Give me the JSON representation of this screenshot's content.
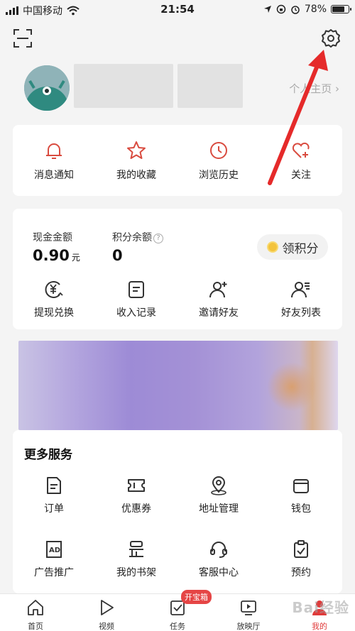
{
  "status_bar": {
    "carrier": "中国移动",
    "time": "21:54",
    "battery": "78%"
  },
  "profile": {
    "link_label": "个人主页 ›"
  },
  "quick_actions": [
    {
      "label": "消息通知",
      "icon": "bell-icon"
    },
    {
      "label": "我的收藏",
      "icon": "star-icon"
    },
    {
      "label": "浏览历史",
      "icon": "clock-icon"
    },
    {
      "label": "关注",
      "icon": "heart-plus-icon"
    }
  ],
  "wallet": {
    "cash_label": "现金金额",
    "cash_value": "0.90",
    "cash_unit": "元",
    "points_label": "积分余额",
    "points_value": "0",
    "claim_label": "领积分",
    "actions": [
      {
        "label": "提现兑换",
        "icon": "yuan-exchange-icon"
      },
      {
        "label": "收入记录",
        "icon": "record-icon"
      },
      {
        "label": "邀请好友",
        "icon": "add-friend-icon"
      },
      {
        "label": "好友列表",
        "icon": "friend-list-icon"
      }
    ]
  },
  "more_services": {
    "title": "更多服务",
    "items": [
      {
        "label": "订单",
        "icon": "order-icon"
      },
      {
        "label": "优惠券",
        "icon": "coupon-icon"
      },
      {
        "label": "地址管理",
        "icon": "location-icon"
      },
      {
        "label": "钱包",
        "icon": "wallet-icon"
      },
      {
        "label": "广告推广",
        "icon": "ad-icon"
      },
      {
        "label": "我的书架",
        "icon": "bookshelf-icon"
      },
      {
        "label": "客服中心",
        "icon": "headset-icon"
      },
      {
        "label": "预约",
        "icon": "clipboard-check-icon"
      }
    ]
  },
  "tabbar": {
    "items": [
      {
        "label": "首页",
        "icon": "home-icon"
      },
      {
        "label": "视频",
        "icon": "play-icon"
      },
      {
        "label": "任务",
        "icon": "task-icon",
        "badge": "开宝箱"
      },
      {
        "label": "放映厅",
        "icon": "screen-icon"
      },
      {
        "label": "我的",
        "icon": "profile-icon"
      }
    ],
    "active": "我的"
  },
  "watermark": "Bai经验",
  "colors": {
    "accent": "#d94b3f",
    "icon": "#333333",
    "annotation_arrow": "#e52a2a"
  }
}
